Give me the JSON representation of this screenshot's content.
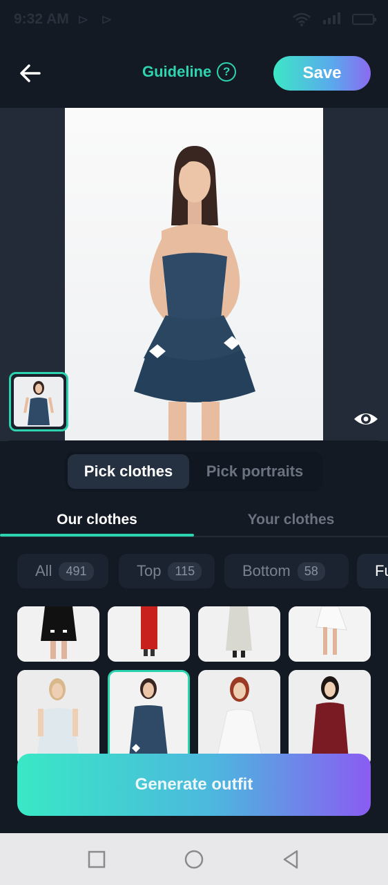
{
  "status_bar": {
    "time": "9:32 AM"
  },
  "header": {
    "guideline_label": "Guideline",
    "guideline_icon": "question-circle-icon",
    "save_label": "Save"
  },
  "picker": {
    "options": [
      "Pick clothes",
      "Pick portraits"
    ],
    "selected": "Pick clothes"
  },
  "tabs": {
    "items": [
      "Our clothes",
      "Your clothes"
    ],
    "selected": "Our clothes"
  },
  "categories": [
    {
      "label": "All",
      "count": "491"
    },
    {
      "label": "Top",
      "count": "115"
    },
    {
      "label": "Bottom",
      "count": "58"
    },
    {
      "label": "Fu",
      "count": ""
    }
  ],
  "actions": {
    "generate_label": "Generate outfit"
  },
  "colors": {
    "accent": "#2dd4b0",
    "background": "#141a24",
    "surface": "#232b38"
  }
}
